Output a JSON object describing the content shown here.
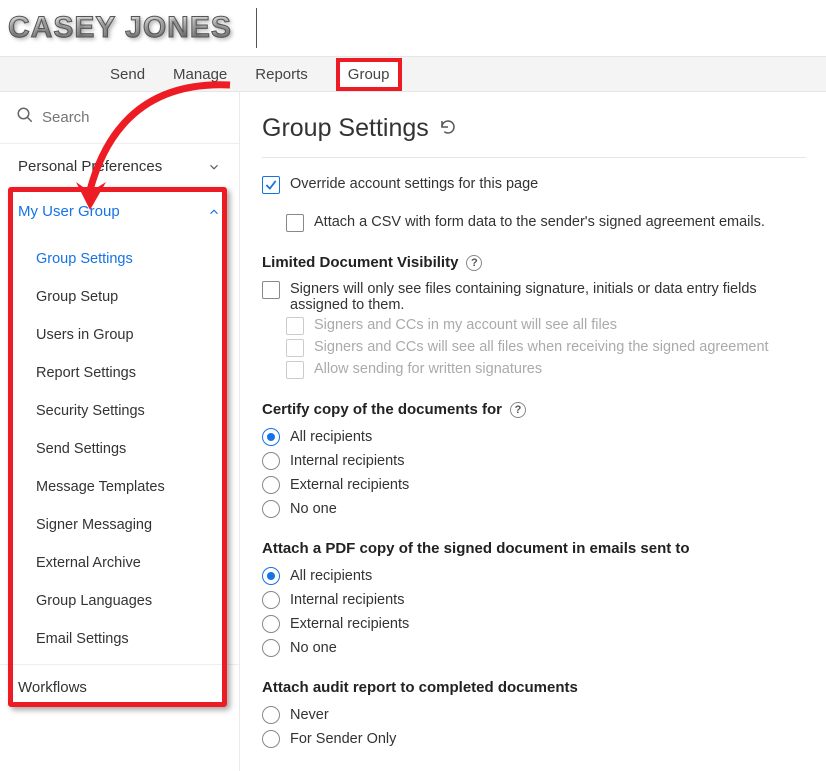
{
  "logo": "CASEY JONES",
  "topnav": {
    "send": "Send",
    "manage": "Manage",
    "reports": "Reports",
    "group": "Group"
  },
  "search": {
    "placeholder": "Search"
  },
  "sidebar": {
    "personal": {
      "label": "Personal Preferences"
    },
    "mygroup": {
      "label": "My User Group",
      "items": [
        "Group Settings",
        "Group Setup",
        "Users in Group",
        "Report Settings",
        "Security Settings",
        "Send Settings",
        "Message Templates",
        "Signer Messaging",
        "External Archive",
        "Group Languages",
        "Email Settings"
      ]
    },
    "workflows": {
      "label": "Workflows"
    }
  },
  "page": {
    "title": "Group Settings",
    "override_label": "Override account settings for this page",
    "attach_csv_label": "Attach a CSV with form data to the sender's signed agreement emails.",
    "ldv": {
      "title": "Limited Document Visibility",
      "main": "Signers will only see files containing signature, initials or data entry fields assigned to them.",
      "sub1": "Signers and CCs in my account will see all files",
      "sub2": "Signers and CCs will see all files when receiving the signed agreement",
      "sub3": "Allow sending for written signatures"
    },
    "certify": {
      "title": "Certify copy of the documents for",
      "opts": [
        "All recipients",
        "Internal recipients",
        "External recipients",
        "No one"
      ]
    },
    "attach_pdf": {
      "title": "Attach a PDF copy of the signed document in emails sent to",
      "opts": [
        "All recipients",
        "Internal recipients",
        "External recipients",
        "No one"
      ]
    },
    "audit": {
      "title": "Attach audit report to completed documents",
      "opts": [
        "Never",
        "For Sender Only"
      ]
    }
  }
}
